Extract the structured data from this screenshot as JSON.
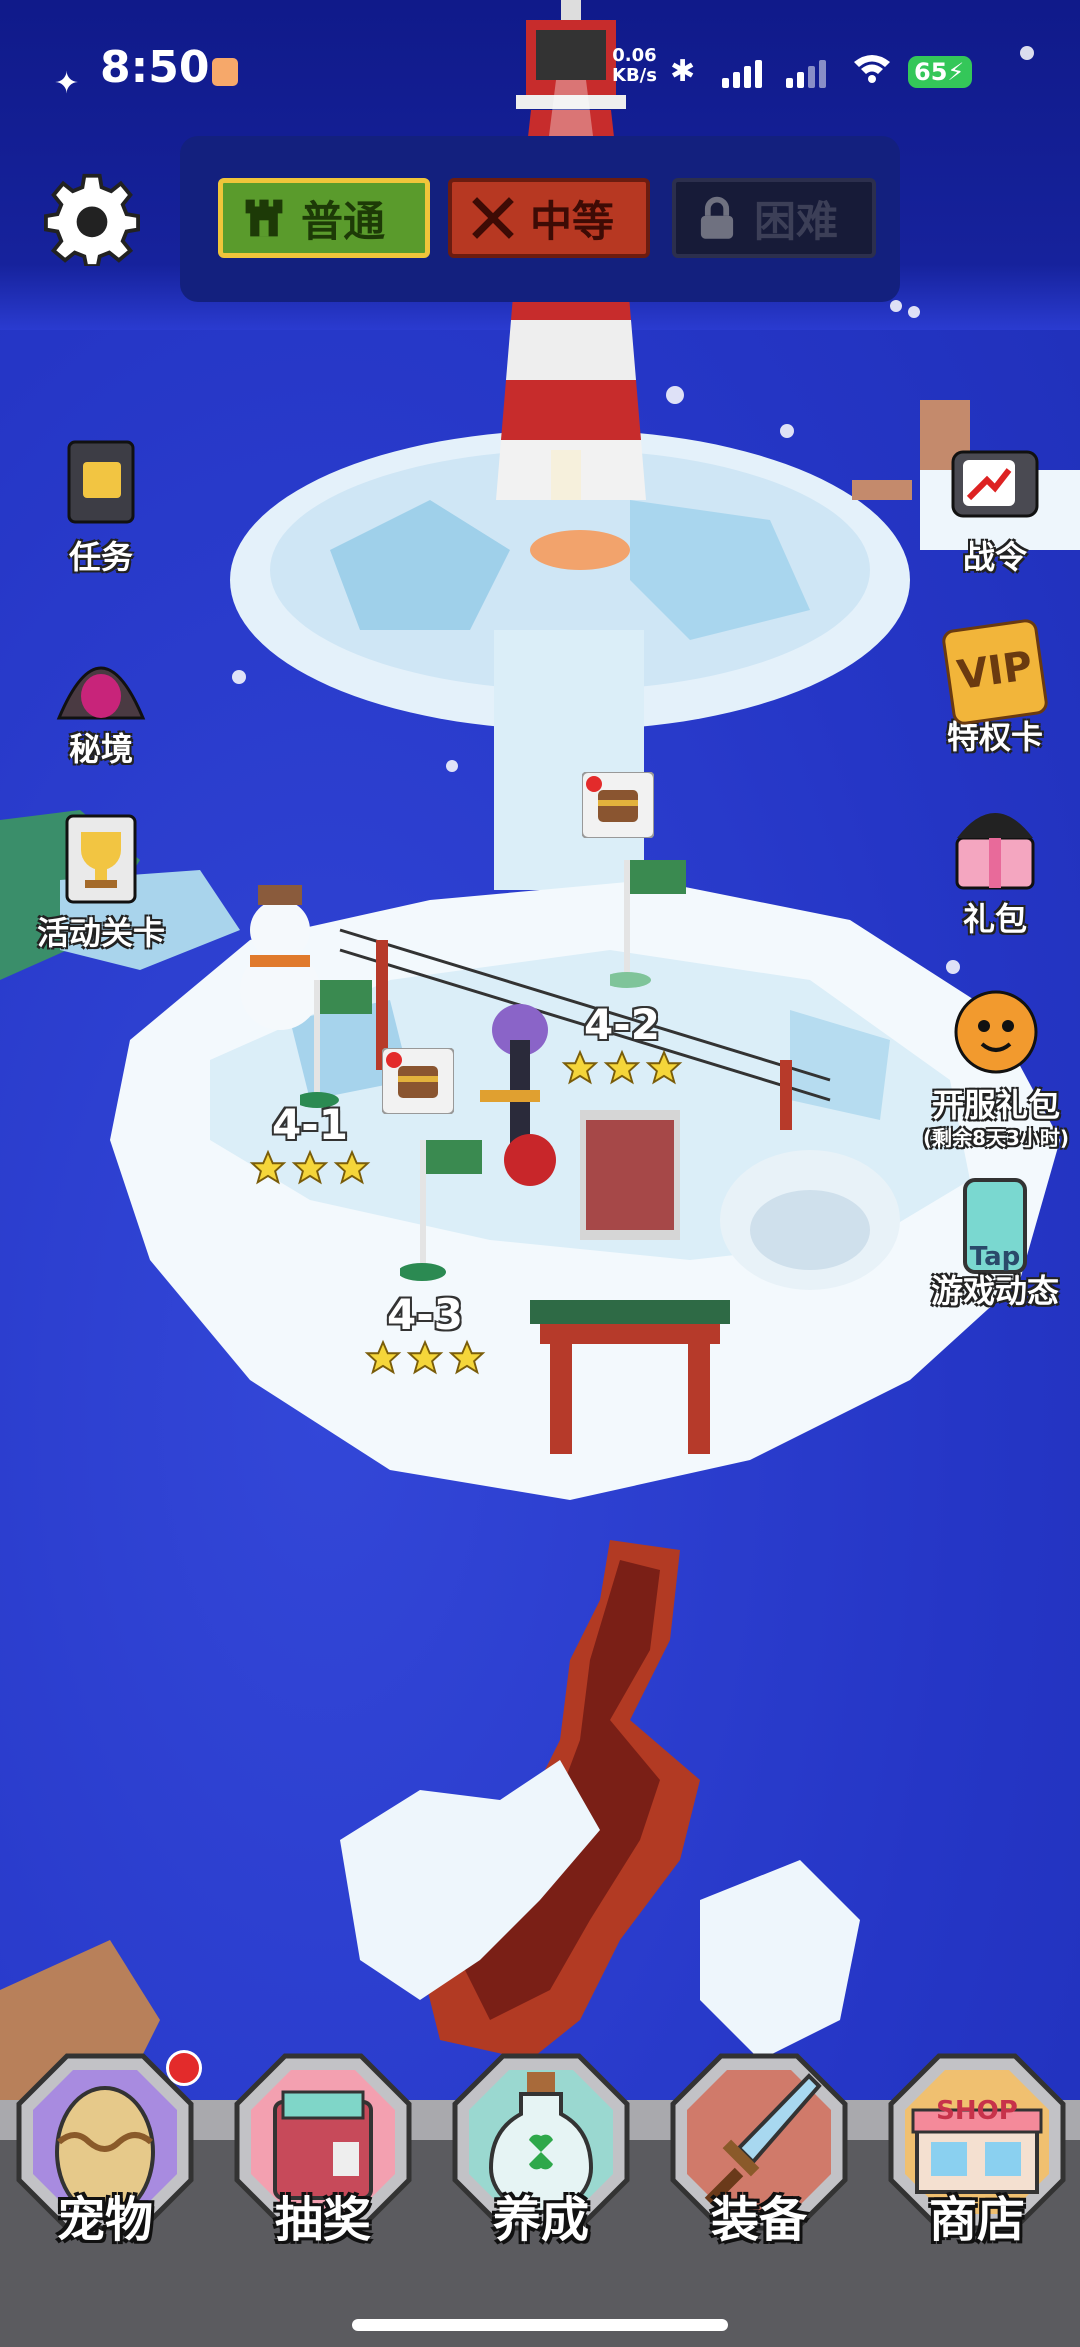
{
  "status": {
    "time": "8:50",
    "net_speed_value": "0.06",
    "net_speed_unit": "KB/s",
    "battery": "65"
  },
  "difficulty": {
    "normal": "普通",
    "medium": "中等",
    "hard": "困难"
  },
  "left_buttons": {
    "tasks": "任务",
    "secret": "秘境",
    "event_stage": "活动关卡"
  },
  "right_buttons": {
    "battle_pass": "战令",
    "vip_card": "特权卡",
    "vip_badge": "VIP",
    "gift_pack": "礼包",
    "server_gift": "开服礼包",
    "server_gift_timer": "(剩余8天3小时)",
    "game_news": "游戏动态",
    "tap_badge": "Tap"
  },
  "stages": [
    {
      "label": "4-1",
      "stars": 3
    },
    {
      "label": "4-2",
      "stars": 3
    },
    {
      "label": "4-3",
      "stars": 3
    }
  ],
  "bottom_nav": {
    "pets": "宠物",
    "lottery": "抽奖",
    "cultivate": "养成",
    "equipment": "装备",
    "shop": "商店",
    "shop_sign": "SHOP"
  },
  "colors": {
    "sea": "#2a3bd0",
    "normal": "#5a9b2c",
    "medium": "#b73822",
    "hard": "#171b38",
    "star": "#f5d63a"
  },
  "icons": [
    "gear-icon",
    "castle-icon",
    "swords-icon",
    "lock-icon",
    "book-icon",
    "cave-icon",
    "trophy-icon",
    "tv-icon",
    "gift-icon",
    "egg-icon",
    "box-icon",
    "bottle-icon",
    "sword-icon",
    "shop-icon",
    "star-icon",
    "chest-icon"
  ]
}
